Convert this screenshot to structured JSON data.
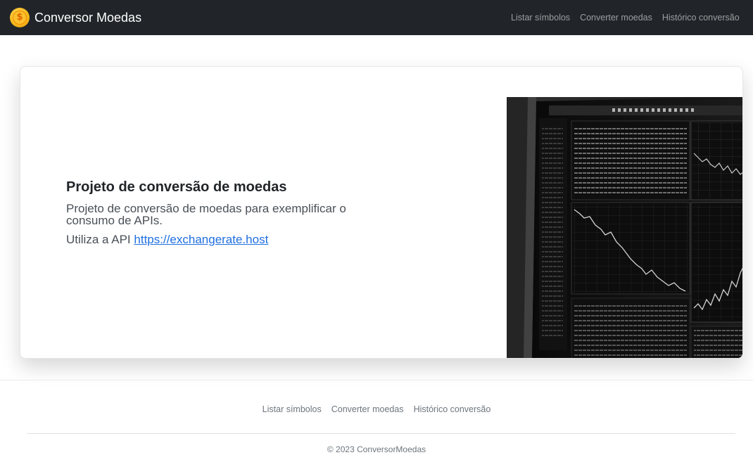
{
  "navbar": {
    "brand": "Conversor Moedas",
    "brand_icon": "coin-dollar-icon",
    "links": [
      "Listar símbolos",
      "Converter moedas",
      "Histórico conversão"
    ]
  },
  "hero": {
    "title": "Projeto de conversão de moedas",
    "lead": "Projeto de conversão de moedas para exemplificar o consumo de APIs.",
    "api_prefix": "Utiliza a API",
    "api_link": "https://exchangerate.host"
  },
  "footer": {
    "links": [
      "Listar símbolos",
      "Converter moedas",
      "Histórico conversão"
    ],
    "copyright": "© 2023 ConversorMoedas"
  },
  "colors": {
    "navbar_bg": "#212529",
    "link": "#1f6fe0",
    "coin": "#f7b91c"
  }
}
